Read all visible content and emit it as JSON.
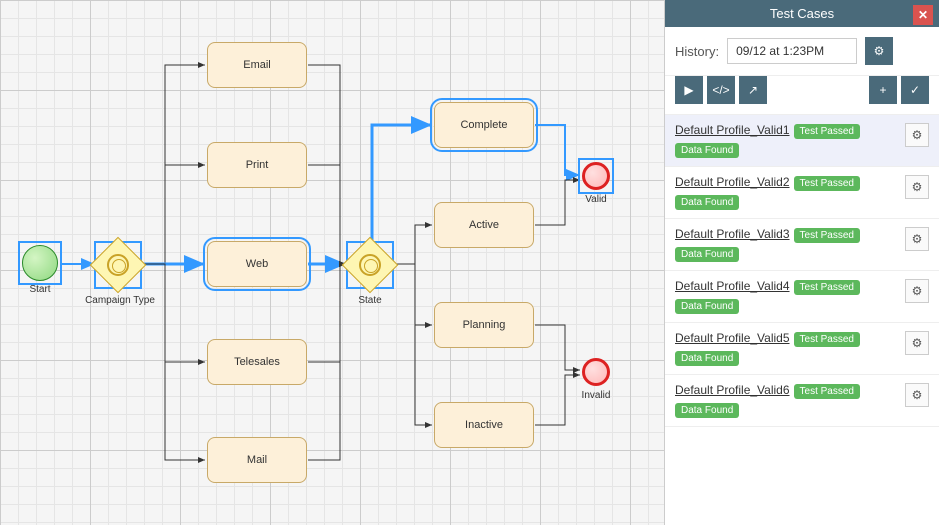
{
  "panel": {
    "title": "Test Cases",
    "history_label": "History:",
    "history_value": "09/12 at 1:23PM"
  },
  "icons": {
    "close": "close-icon",
    "gear": "gear-icon",
    "play": "play-icon",
    "code": "code-icon",
    "share": "share-icon",
    "plus": "plus-icon",
    "check": "check-icon"
  },
  "diagram": {
    "start": "Start",
    "gateway1": "Campaign Type",
    "gateway2": "State",
    "tasks": {
      "email": "Email",
      "print": "Print",
      "web": "Web",
      "telesales": "Telesales",
      "mail": "Mail",
      "complete": "Complete",
      "active": "Active",
      "planning": "Planning",
      "inactive": "Inactive"
    },
    "end_valid": "Valid",
    "end_invalid": "Invalid"
  },
  "test_cases": [
    {
      "name": "Default Profile_Valid1",
      "status": "Test Passed",
      "data": "Data Found",
      "selected": true
    },
    {
      "name": "Default Profile_Valid2",
      "status": "Test Passed",
      "data": "Data Found",
      "selected": false
    },
    {
      "name": "Default Profile_Valid3",
      "status": "Test Passed",
      "data": "Data Found",
      "selected": false
    },
    {
      "name": "Default Profile_Valid4",
      "status": "Test Passed",
      "data": "Data Found",
      "selected": false
    },
    {
      "name": "Default Profile_Valid5",
      "status": "Test Passed",
      "data": "Data Found",
      "selected": false
    },
    {
      "name": "Default Profile_Valid6",
      "status": "Test Passed",
      "data": "Data Found",
      "selected": false
    }
  ]
}
